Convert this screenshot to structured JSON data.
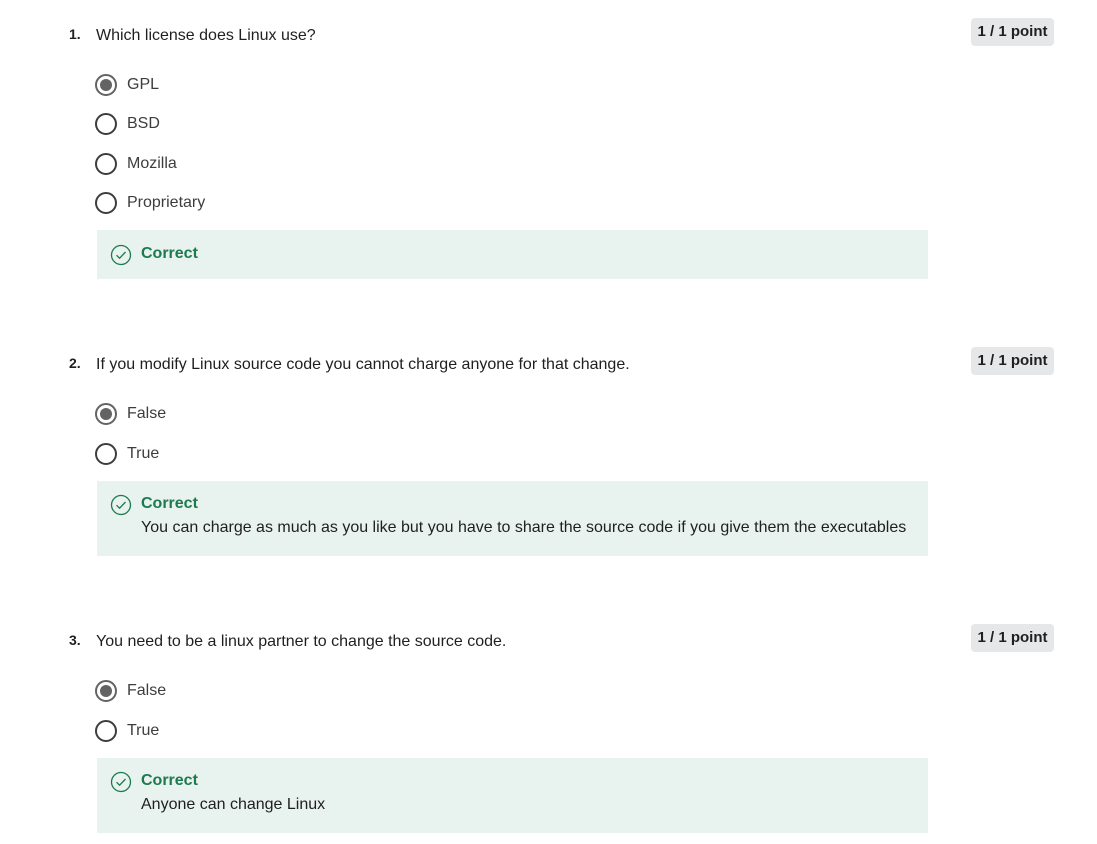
{
  "questions": [
    {
      "number": "1.",
      "text": "Which license does Linux use?",
      "points": "1 / 1 point",
      "options": [
        {
          "label": "GPL",
          "selected": true
        },
        {
          "label": "BSD",
          "selected": false
        },
        {
          "label": "Mozilla",
          "selected": false
        },
        {
          "label": "Proprietary",
          "selected": false
        }
      ],
      "feedback": {
        "title": "Correct",
        "text": ""
      }
    },
    {
      "number": "2.",
      "text": "If you modify Linux source code you cannot charge anyone for that change.",
      "points": "1 / 1 point",
      "options": [
        {
          "label": "False",
          "selected": true
        },
        {
          "label": "True",
          "selected": false
        }
      ],
      "feedback": {
        "title": "Correct",
        "text": "You can charge as much as you like but you have to share the source code if you give them the executables"
      }
    },
    {
      "number": "3.",
      "text": "You need to be a linux partner to change the source code.",
      "points": "1 / 1 point",
      "options": [
        {
          "label": "False",
          "selected": true
        },
        {
          "label": "True",
          "selected": false
        }
      ],
      "feedback": {
        "title": "Correct",
        "text": "Anyone can change Linux"
      }
    }
  ],
  "colors": {
    "feedback_background": "#e8f2ee",
    "correct_green": "#1d7a4f",
    "points_badge": "#e5e7e8"
  },
  "icons": {
    "feedback": "check-circle-icon",
    "option": "radio-button"
  }
}
